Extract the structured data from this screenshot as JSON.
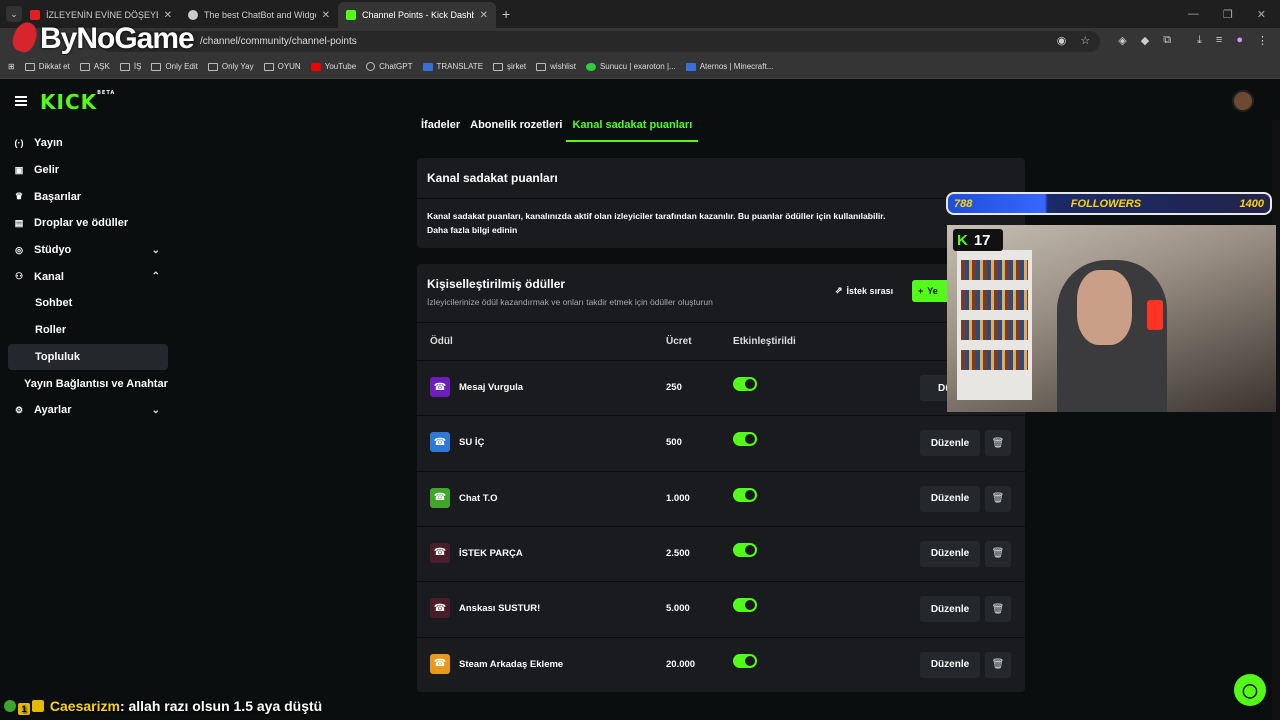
{
  "browser": {
    "tabs": [
      {
        "title": "İZLEYENİN EVİNE DÖŞEYEN KICK",
        "color": "#e02020"
      },
      {
        "title": "The best ChatBot and Widgets",
        "color": "#cccccc"
      },
      {
        "title": "Channel Points - Kick Dashboard",
        "color": "#53fc18"
      }
    ],
    "url": "/channel/community/channel-points",
    "watermark": "ByNoGame",
    "bookmarks": [
      "Dikkat et",
      "AŞK",
      "İŞ",
      "Only Edit",
      "Only Yay",
      "OYUN",
      "YouTube",
      "ChatGPT",
      "TRANSLATE",
      "şirket",
      "wishlist",
      "Sunucu | exaroton |...",
      "Aternos | Minecraft..."
    ]
  },
  "kick": {
    "logo": "KICK",
    "logo_sup": "BETA"
  },
  "sidebar": {
    "items": [
      {
        "label": "Yayın",
        "icon": "broadcast-icon"
      },
      {
        "label": "Gelir",
        "icon": "money-icon"
      },
      {
        "label": "Başarılar",
        "icon": "trophy-icon"
      },
      {
        "label": "Droplar ve ödüller",
        "icon": "gift-icon"
      },
      {
        "label": "Stüdyo",
        "icon": "studio-icon"
      },
      {
        "label": "Kanal",
        "icon": "users-icon"
      },
      {
        "label": "Sohbet"
      },
      {
        "label": "Roller"
      },
      {
        "label": "Topluluk"
      },
      {
        "label": "Yayın Bağlantısı ve Anahtarı"
      },
      {
        "label": "Ayarlar",
        "icon": "gear-icon"
      }
    ]
  },
  "tabs": [
    "İfadeler",
    "Abonelik rozetleri",
    "Kanal sadakat puanları"
  ],
  "info_card": {
    "title": "Kanal sadakat puanları",
    "text": "Kanal sadakat puanları, kanalınızda aktif olan izleyiciler tarafından kazanılır. Bu puanlar ödüller için kullanılabilir.",
    "link": "Daha fazla bilgi edinin"
  },
  "rewards_card": {
    "title": "Kişiselleştirilmiş ödüller",
    "description": "İzleyicilerinize ödül kazandırmak ve onları takdir etmek için ödüller oluşturun",
    "request_queue": "İstek sırası",
    "new_button": "Ye",
    "columns": {
      "reward": "Ödül",
      "cost": "Ücret",
      "enabled": "Etkinleştirildi"
    },
    "edit_label": "Düzenle",
    "rows": [
      {
        "name": "Mesaj Vurgula",
        "cost": "250",
        "color": "#6b1fb8",
        "enabled": true,
        "edit": "Düze"
      },
      {
        "name": "SU İÇ",
        "cost": "500",
        "color": "#2c7ad6",
        "enabled": true,
        "edit": "Düzenle"
      },
      {
        "name": "Chat T.O",
        "cost": "1.000",
        "color": "#3fa62b",
        "enabled": true,
        "edit": "Düzenle"
      },
      {
        "name": "İSTEK PARÇA",
        "cost": "2.500",
        "color": "#4a1d2a",
        "enabled": true,
        "edit": "Düzenle"
      },
      {
        "name": "Anskası SUSTUR!",
        "cost": "5.000",
        "color": "#4a1d2a",
        "enabled": true,
        "edit": "Düzenle"
      },
      {
        "name": "Steam Arkadaş Ekleme",
        "cost": "20.000",
        "color": "#e59a1c",
        "enabled": true,
        "edit": "Düzenle"
      }
    ]
  },
  "overlay": {
    "followers_current": "788",
    "followers_label": "FOLLOWERS",
    "followers_goal": "1400",
    "viewer_count": "17"
  },
  "chat": {
    "badge_count": "1",
    "user": "Caesarizm",
    "message": ": allah razı olsun 1.5 aya düştü"
  }
}
